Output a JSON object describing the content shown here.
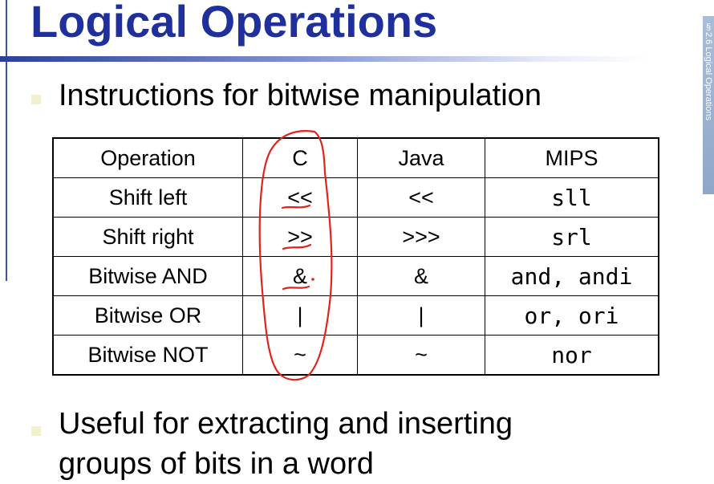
{
  "slide": {
    "title": "Logical Operations",
    "side_label": "§2.6 Logical Operations",
    "bullets": [
      {
        "text": "Instructions for bitwise manipulation"
      },
      {
        "lines": [
          "Useful for extracting and inserting",
          "groups of bits in a word"
        ]
      }
    ]
  },
  "table": {
    "headers": [
      "Operation",
      "C",
      "Java",
      "MIPS"
    ],
    "rows": [
      [
        "Shift left",
        "<<",
        "<<",
        "sll"
      ],
      [
        "Shift right",
        ">>",
        ">>>",
        "srl"
      ],
      [
        "Bitwise AND",
        "&",
        "&",
        "and, andi"
      ],
      [
        "Bitwise OR",
        "|",
        "|",
        "or, ori"
      ],
      [
        "Bitwise NOT",
        "~",
        "~",
        "nor"
      ]
    ]
  },
  "annotation": {
    "color": "#e0241b",
    "kind": "handwritten-ink",
    "marks": [
      "circle-around-C-column",
      "underline-shift-left",
      "underline-shift-right",
      "underline-and",
      "dot-after-and"
    ]
  }
}
